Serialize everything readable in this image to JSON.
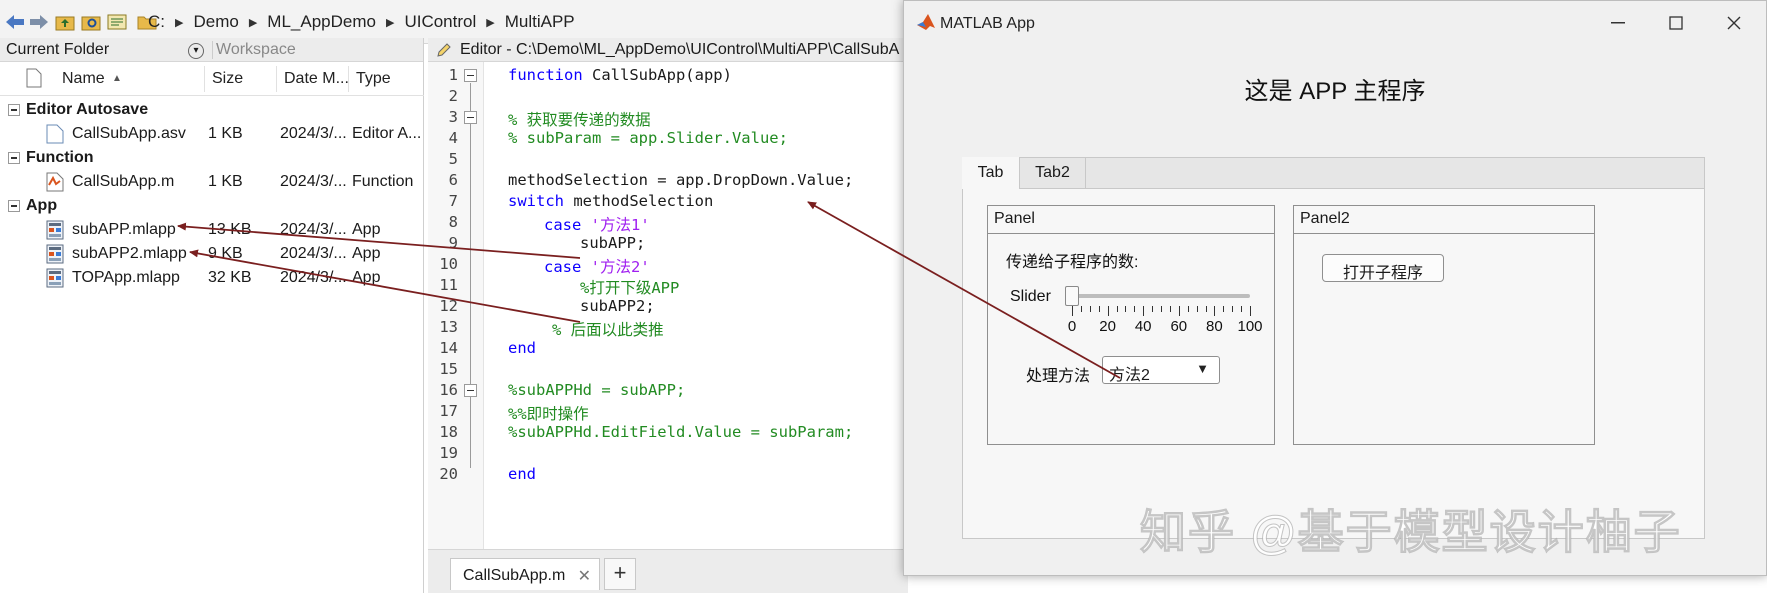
{
  "address_bar": {
    "path": [
      "C:",
      "Demo",
      "ML_AppDemo",
      "UIControl",
      "MultiAPP"
    ]
  },
  "folder_panel": {
    "tab_current": "Current Folder",
    "tab_workspace": "Workspace",
    "columns": {
      "name": "Name",
      "size": "Size",
      "date": "Date M...",
      "type": "Type"
    },
    "groups": [
      {
        "label": "Editor Autosave",
        "files": [
          {
            "name": "CallSubApp.asv",
            "size": "1 KB",
            "date": "2024/3/...",
            "type": "Editor A..."
          }
        ]
      },
      {
        "label": "Function",
        "files": [
          {
            "name": "CallSubApp.m",
            "size": "1 KB",
            "date": "2024/3/...",
            "type": "Function"
          }
        ]
      },
      {
        "label": "App",
        "files": [
          {
            "name": "subAPP.mlapp",
            "size": "13 KB",
            "date": "2024/3/...",
            "type": "App"
          },
          {
            "name": "subAPP2.mlapp",
            "size": "9 KB",
            "date": "2024/3/...",
            "type": "App"
          },
          {
            "name": "TOPApp.mlapp",
            "size": "32 KB",
            "date": "2024/3/...",
            "type": "App"
          }
        ]
      }
    ]
  },
  "editor": {
    "title": "Editor - C:\\Demo\\ML_AppDemo\\UIControl\\MultiAPP\\CallSubA",
    "line_numbers": [
      "1",
      "2",
      "3",
      "4",
      "5",
      "6",
      "7",
      "8",
      "9",
      "10",
      "11",
      "12",
      "13",
      "14",
      "15",
      "16",
      "17",
      "18",
      "19",
      "20"
    ],
    "code": {
      "l1_kw": "function",
      "l1_rest": " CallSubApp(app)",
      "l3": "% 获取要传递的数据",
      "l4": "% subParam = app.Slider.Value;",
      "l6": "methodSelection = app.DropDown.Value;",
      "l7_kw": "switch",
      "l7_rest": " methodSelection",
      "l8_kw": "case",
      "l8_str": "'方法1'",
      "l9": "subAPP;",
      "l10_kw": "case",
      "l10_str": "'方法2'",
      "l11": "%打开下级APP",
      "l12": "subAPP2;",
      "l13": "% 后面以此类推",
      "l14": "end",
      "l16": "%subAPPHd = subAPP;",
      "l17": "%%即时操作",
      "l18": "%subAPPHd.EditField.Value = subParam;",
      "l20": "end"
    },
    "tab_label": "CallSubApp.m",
    "tab_close": "✕",
    "add_tab": "+"
  },
  "app_window": {
    "title": "MATLAB App",
    "heading": "这是 APP 主程序",
    "tabs": [
      "Tab",
      "Tab2"
    ],
    "panel1": {
      "title": "Panel",
      "caption": "传递给子程序的数:",
      "slider_label": "Slider",
      "slider_value": 0,
      "slider_ticks": [
        "0",
        "20",
        "40",
        "60",
        "80",
        "100"
      ],
      "dropdown_label": "处理方法",
      "dropdown_value": "方法2"
    },
    "panel2": {
      "title": "Panel2",
      "button": "打开子程序"
    }
  },
  "watermark": "知乎 @基于模型设计柚子",
  "colors": {
    "keyword": "#0e00ff",
    "comment": "#228b22",
    "string": "#a020f0",
    "arrow": "#7a1f1f"
  }
}
